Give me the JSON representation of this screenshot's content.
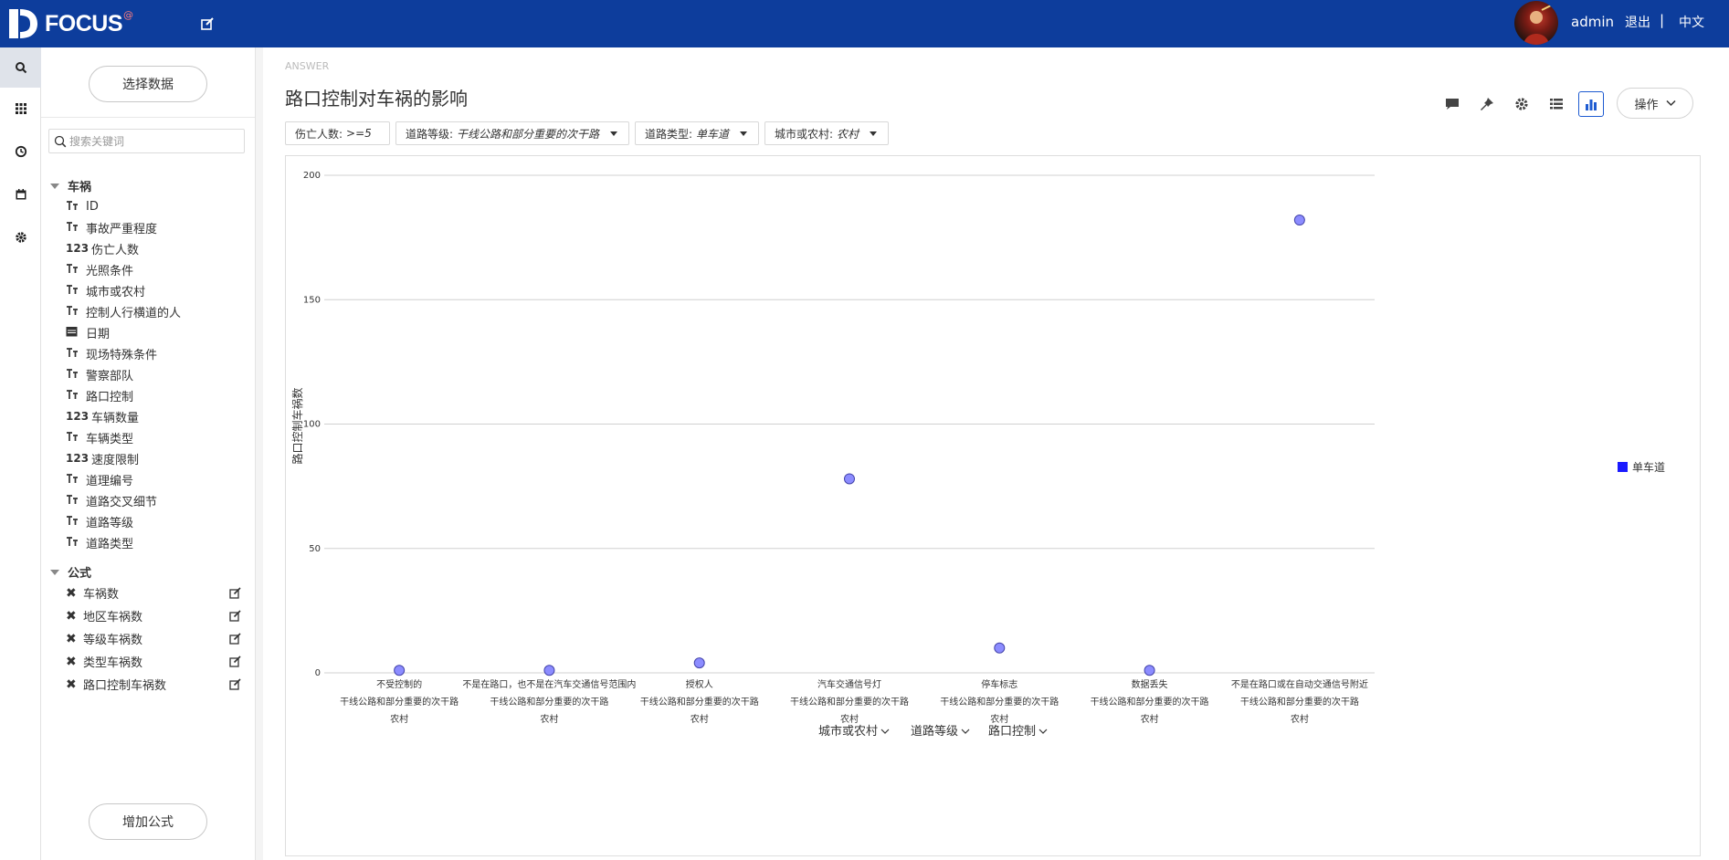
{
  "app": {
    "brand": "FOCUS",
    "brand_sup": "@"
  },
  "header": {
    "username": "admin",
    "logout": "退出",
    "separator": "|",
    "language": "中文"
  },
  "iconbar": {
    "items": [
      "search-icon",
      "apps-icon",
      "history-icon",
      "calendar-icon",
      "settings-icon"
    ]
  },
  "sidebar": {
    "select_data": "选择数据",
    "search_placeholder": "搜索关键词",
    "group1": "车祸",
    "fields": [
      {
        "type": "T",
        "label": "ID"
      },
      {
        "type": "T",
        "label": "事故严重程度"
      },
      {
        "type": "123",
        "label": "伤亡人数"
      },
      {
        "type": "T",
        "label": "光照条件"
      },
      {
        "type": "T",
        "label": "城市或农村"
      },
      {
        "type": "T",
        "label": "控制人行横道的人"
      },
      {
        "type": "date",
        "label": "日期"
      },
      {
        "type": "T",
        "label": "现场特殊条件"
      },
      {
        "type": "T",
        "label": "警察部队"
      },
      {
        "type": "T",
        "label": "路口控制"
      },
      {
        "type": "123",
        "label": "车辆数量"
      },
      {
        "type": "T",
        "label": "车辆类型"
      },
      {
        "type": "123",
        "label": "速度限制"
      },
      {
        "type": "T",
        "label": "道理编号"
      },
      {
        "type": "T",
        "label": "道路交叉细节"
      },
      {
        "type": "T",
        "label": "道路等级"
      },
      {
        "type": "T",
        "label": "道路类型"
      }
    ],
    "group2": "公式",
    "formulas": [
      "车祸数",
      "地区车祸数",
      "等级车祸数",
      "类型车祸数",
      "路口控制车祸数"
    ],
    "add_formula": "增加公式"
  },
  "main": {
    "answer_label": "ANSWER",
    "title": "路口控制对车祸的影响",
    "ops_label": "操作",
    "filters": [
      {
        "key": "伤亡人数:",
        "value": ">=5"
      },
      {
        "key": "道路等级:",
        "value": "干线公路和部分重要的次干路"
      },
      {
        "key": "道路类型:",
        "value": "单车道"
      },
      {
        "key": "城市或农村:",
        "value": "农村"
      }
    ]
  },
  "chart_data": {
    "type": "scatter",
    "ylabel": "路口控制车祸数",
    "ylim": [
      0,
      200
    ],
    "yticks": [
      0,
      50,
      100,
      150,
      200
    ],
    "grid": true,
    "legend_position": "right",
    "series": [
      {
        "name": "单车道",
        "color": "#8c8cff",
        "values": [
          1,
          1,
          4,
          78,
          10,
          1,
          182
        ]
      }
    ],
    "categories": [
      [
        "不受控制的",
        "干线公路和部分重要的次干路",
        "农村"
      ],
      [
        "不是在路口，也不是在汽车交通信号范围内",
        "干线公路和部分重要的次干路",
        "农村"
      ],
      [
        "授权人",
        "干线公路和部分重要的次干路",
        "农村"
      ],
      [
        "汽车交通信号灯",
        "干线公路和部分重要的次干路",
        "农村"
      ],
      [
        "停车标志",
        "干线公路和部分重要的次干路",
        "农村"
      ],
      [
        "数据丢失",
        "干线公路和部分重要的次干路",
        "农村"
      ],
      [
        "不是在路口或在自动交通信号附近",
        "干线公路和部分重要的次干路",
        "农村"
      ]
    ],
    "x_dimensions": [
      "城市或农村",
      "道路等级",
      "路口控制"
    ]
  }
}
